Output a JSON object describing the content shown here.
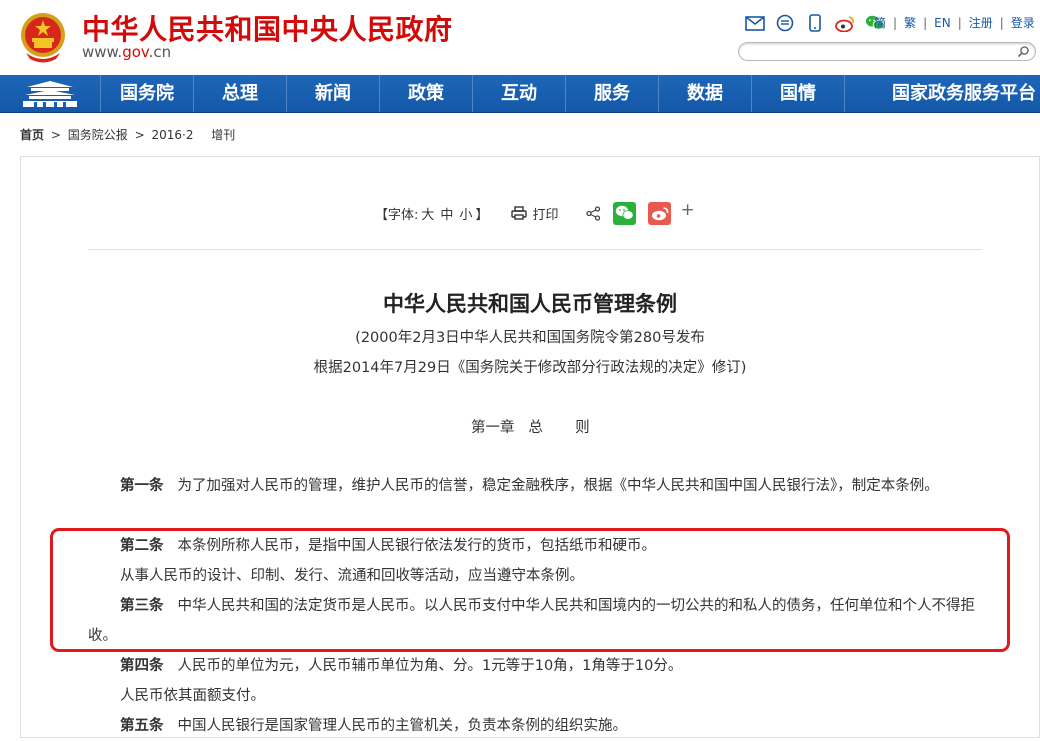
{
  "header": {
    "site_title": "中华人民共和国中央人民政府",
    "site_url_prefix": "www.",
    "site_url_domain": "gov",
    "site_url_suffix": ".cn",
    "links": [
      "简",
      "繁",
      "EN",
      "注册",
      "登录"
    ],
    "search_placeholder": ""
  },
  "nav": {
    "items": [
      "国务院",
      "总理",
      "新闻",
      "政策",
      "互动",
      "服务",
      "数据",
      "国情",
      "国家政务服务平台"
    ]
  },
  "breadcrumb": {
    "home": "首页",
    "sep": ">",
    "section": "国务院公报",
    "year": "2016·2",
    "issue": "增刊"
  },
  "toolbar": {
    "font_label_open": "【字体:",
    "font_large": "大",
    "font_medium": "中",
    "font_small": "小",
    "font_label_close": "】",
    "print_label": "打印",
    "plus": "+"
  },
  "document": {
    "title": "中华人民共和国人民币管理条例",
    "subtitle_1": "(2000年2月3日中华人民共和国国务院令第280号发布",
    "subtitle_2": "根据2014年7月29日《国务院关于修改部分行政法规的决定》修订)",
    "chapter": "第一章   总       则",
    "articles": [
      {
        "label": "第一条",
        "text": "为了加强对人民币的管理，维护人民币的信誉，稳定金融秩序，根据《中华人民共和国中国人民银行法》，制定本条例。"
      },
      {
        "label": "第二条",
        "text": "本条例所称人民币，是指中国人民银行依法发行的货币，包括纸币和硬币。"
      },
      {
        "label": "",
        "text": "从事人民币的设计、印制、发行、流通和回收等活动，应当遵守本条例。"
      },
      {
        "label": "第三条",
        "text": "中华人民共和国的法定货币是人民币。以人民币支付中华人民共和国境内的一切公共的和私人的债务，任何单位和个人不得拒收。"
      },
      {
        "label": "第四条",
        "text": "人民币的单位为元，人民币辅币单位为角、分。1元等于10角，1角等于10分。"
      },
      {
        "label": "",
        "text": "人民币依其面额支付。"
      },
      {
        "label": "第五条",
        "text": "中国人民银行是国家管理人民币的主管机关，负责本条例的组织实施。"
      }
    ]
  },
  "colors": {
    "brand_red": "#d20a0a",
    "nav_blue": "#1a5fb0",
    "highlight_red": "#e0191b",
    "wechat_green": "#2ab13b",
    "weibo_red": "#e8594f"
  }
}
